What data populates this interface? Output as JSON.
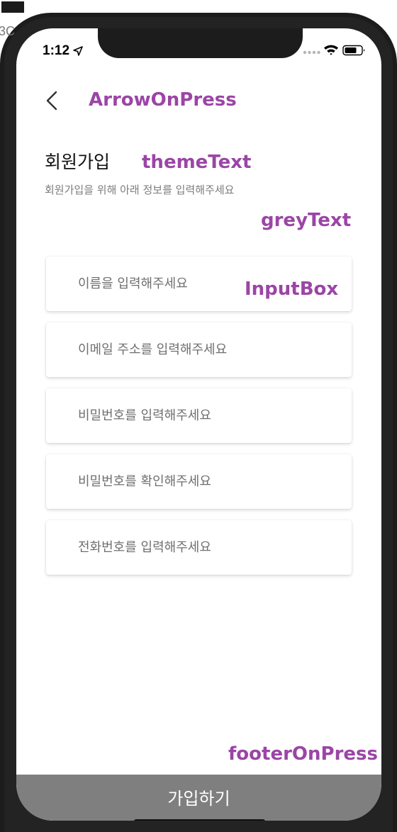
{
  "status_bar": {
    "time": "1:12",
    "location_icon": "location-arrow-icon",
    "signal_icon": "signal-dots-icon",
    "wifi_icon": "wifi-icon",
    "battery_icon": "battery-icon"
  },
  "edge_text": "3C",
  "annotations": {
    "arrow": "ArrowOnPress",
    "theme": "themeText",
    "grey": "greyText",
    "input": "InputBox",
    "footer": "footerOnPress",
    "color": "#9b45a6"
  },
  "header": {
    "back_icon": "chevron-left-icon",
    "title": "회원가입",
    "subtitle": "회원가입을 위해 아래 정보를 입력해주세요"
  },
  "form": {
    "fields": [
      {
        "placeholder": "이름을 입력해주세요",
        "value": ""
      },
      {
        "placeholder": "이메일 주소를 입력해주세요",
        "value": ""
      },
      {
        "placeholder": "비밀번호를 입력해주세요",
        "value": ""
      },
      {
        "placeholder": "비밀번호를 확인해주세요",
        "value": ""
      },
      {
        "placeholder": "전화번호를 입력해주세요",
        "value": ""
      }
    ]
  },
  "footer": {
    "label": "가입하기",
    "color": "#7f7f7f"
  }
}
